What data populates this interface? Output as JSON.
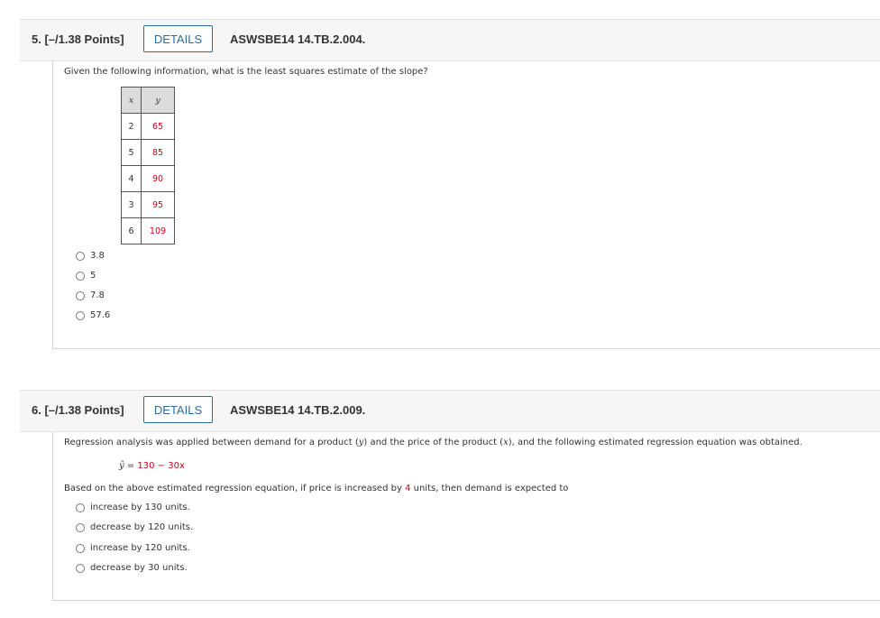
{
  "q5": {
    "number_label": "5.  [–/1.38 Points]",
    "details_label": "DETAILS",
    "code": "ASWSBE14 14.TB.2.004.",
    "prompt": "Given the following information, what is the least squares estimate of the slope?",
    "table": {
      "header_x": "x",
      "header_y": "y",
      "rows": [
        {
          "x": "2",
          "y": "65"
        },
        {
          "x": "5",
          "y": "85"
        },
        {
          "x": "4",
          "y": "90"
        },
        {
          "x": "3",
          "y": "95"
        },
        {
          "x": "6",
          "y": "109"
        }
      ]
    },
    "options": [
      "3.8",
      "5",
      "7.8",
      "57.6"
    ]
  },
  "q6": {
    "number_label": "6.  [–/1.38 Points]",
    "details_label": "DETAILS",
    "code": "ASWSBE14 14.TB.2.009.",
    "prompt_part1": "Regression analysis was applied between demand for a product (",
    "prompt_var_y": "y",
    "prompt_part2": ") and the price of the product (",
    "prompt_var_x": "x",
    "prompt_part3": "), and the following estimated regression equation was obtained.",
    "equation": {
      "lhs": "ŷ",
      "equals": " = ",
      "rhs": "130 − 30x"
    },
    "question_part1": "Based on the above estimated regression equation, if price is increased by ",
    "question_value": "4",
    "question_part2": " units, then demand is expected to",
    "options": [
      "increase by 130 units.",
      "decrease by 120 units.",
      "increase by 120 units.",
      "decrease by 30 units."
    ]
  },
  "colors": {
    "accent": "#2b6ca3",
    "value_red": "#d0021b",
    "header_bg": "#f6f6f6"
  }
}
